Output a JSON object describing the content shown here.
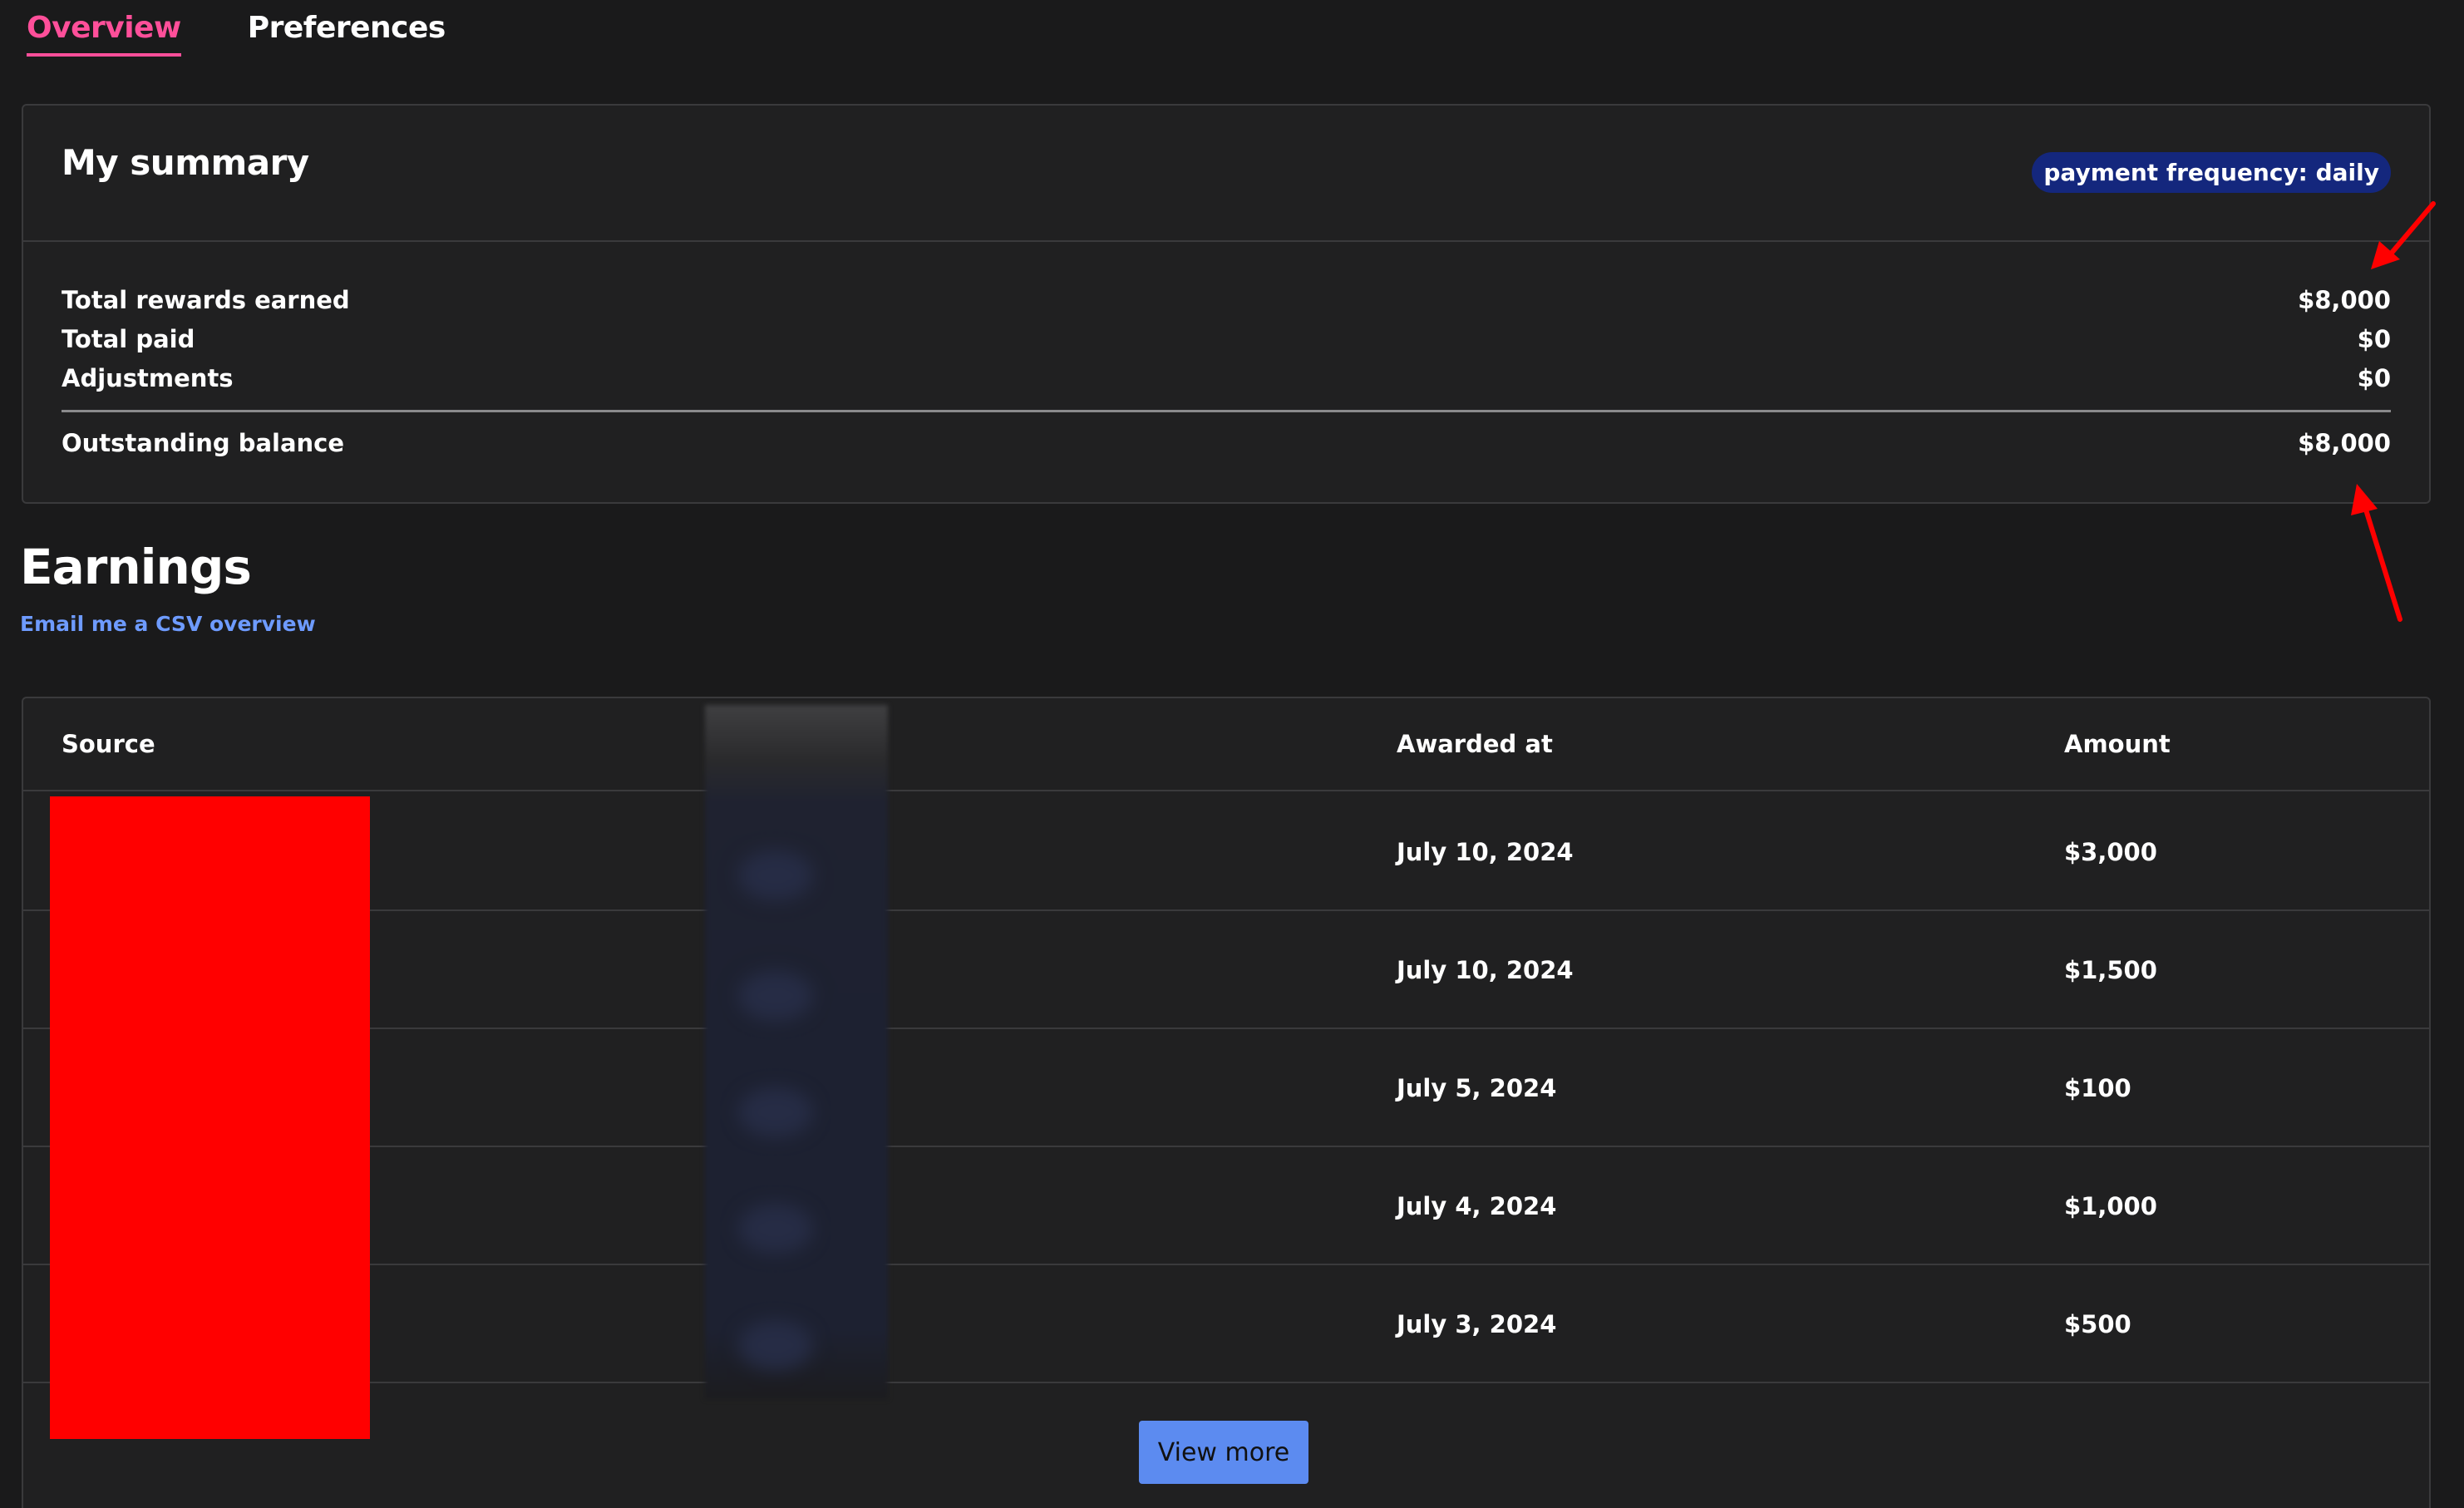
{
  "tabs": [
    {
      "label": "Overview",
      "active": true
    },
    {
      "label": "Preferences",
      "active": false
    }
  ],
  "summary": {
    "title": "My summary",
    "badge": "payment frequency: daily",
    "rows": [
      {
        "label": "Total rewards earned",
        "value": "$8,000"
      },
      {
        "label": "Total paid",
        "value": "$0"
      },
      {
        "label": "Adjustments",
        "value": "$0"
      }
    ],
    "outstanding": {
      "label": "Outstanding balance",
      "value": "$8,000"
    }
  },
  "earnings": {
    "title": "Earnings",
    "csv_link": "Email me a CSV overview",
    "columns": {
      "source": "Source",
      "awarded_at": "Awarded at",
      "amount": "Amount"
    },
    "rows": [
      {
        "awarded_at": "July 10, 2024",
        "amount": "$3,000"
      },
      {
        "awarded_at": "July 10, 2024",
        "amount": "$1,500"
      },
      {
        "awarded_at": "July 5, 2024",
        "amount": "$100"
      },
      {
        "awarded_at": "July 4, 2024",
        "amount": "$1,000"
      },
      {
        "awarded_at": "July 3, 2024",
        "amount": "$500"
      }
    ],
    "view_more": "View more"
  },
  "colors": {
    "background": "#1a1a1b",
    "card": "#202021",
    "accent_tab": "#ff4f9a",
    "badge": "#14277d",
    "link": "#6e9bff",
    "button": "#5c8bf0",
    "annotation_arrow": "#ff0000"
  }
}
